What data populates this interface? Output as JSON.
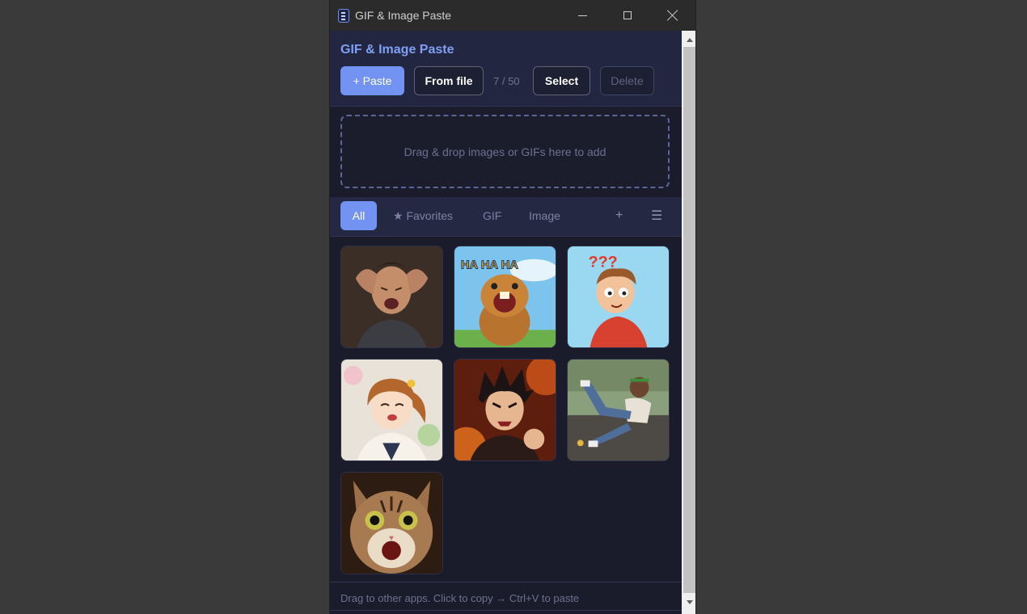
{
  "window": {
    "title": "GIF & Image Paste",
    "controls": [
      "minimize-icon",
      "maximize-icon",
      "close-icon"
    ]
  },
  "header": {
    "app_title": "GIF & Image Paste",
    "paste_label": "+ Paste",
    "from_file_label": "From file",
    "count": "7 / 50",
    "select_label": "Select",
    "delete_label": "Delete"
  },
  "dropzone": {
    "text": "Drag & drop images or GIFs here to add"
  },
  "tabs": {
    "all": "All",
    "favorites": "★ Favorites",
    "gif": "GIF",
    "image": "Image",
    "add": "+",
    "menu": "☰",
    "active": "All"
  },
  "gallery": {
    "items": [
      {
        "name": "stressed-man-thumbnail"
      },
      {
        "name": "laughing-beaver-thumbnail",
        "caption": "HA HA HA"
      },
      {
        "name": "confused-cartoon-boy-thumbnail",
        "caption": "???"
      },
      {
        "name": "happy-anime-girl-thumbnail"
      },
      {
        "name": "angry-anime-boy-thumbnail"
      },
      {
        "name": "man-slipping-thumbnail"
      },
      {
        "name": "shocked-cat-thumbnail"
      }
    ]
  },
  "status": {
    "text": "Drag to other apps. Click to copy → Ctrl+V to paste"
  },
  "colors": {
    "accent": "#7393f2",
    "background": "#1b1c2b",
    "header_bg": "#232640",
    "title_accent": "#7f9ff5"
  }
}
